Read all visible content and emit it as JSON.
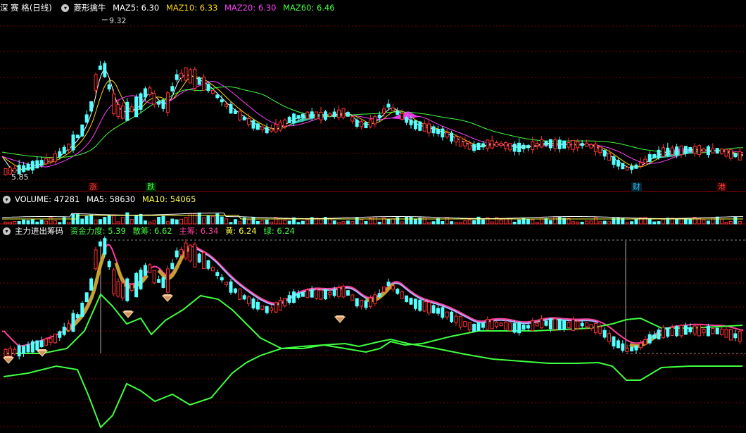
{
  "main_panel": {
    "stock_name": "深 赛 格",
    "period": "(日线)",
    "indicator_name": "菱形擒牛",
    "ma_values": [
      {
        "label": "MAZ5",
        "value": "6.30",
        "color": "#ffffff"
      },
      {
        "label": "MAZ10",
        "value": "6.33",
        "color": "#ffd700"
      },
      {
        "label": "MAZ20",
        "value": "6.30",
        "color": "#ff40ff"
      },
      {
        "label": "MAZ60",
        "value": "6.46",
        "color": "#40ff40"
      }
    ],
    "high_label": "9.32",
    "low_label": "5.85",
    "signals": [
      {
        "text": "涨",
        "color": "#ff4040"
      },
      {
        "text": "跌",
        "color": "#40ff40"
      },
      {
        "text": "财",
        "color": "#40c0ff"
      },
      {
        "text": "港",
        "color": "#ff4040"
      }
    ]
  },
  "volume_panel": {
    "label": "VOLUME",
    "value": "47281",
    "ma5_label": "MA5",
    "ma5": "58630",
    "ma10_label": "MA10",
    "ma10": "54065"
  },
  "indicator_panel": {
    "name": "主力进出筹码",
    "items": [
      {
        "label": "资金力度",
        "value": "5.39",
        "color": "#40ff40"
      },
      {
        "label": "散筹",
        "value": "6.62",
        "color": "#40ff40"
      },
      {
        "label": "主筹",
        "value": "6.34",
        "color": "#ff40a0"
      },
      {
        "label": "黄",
        "value": "6.24",
        "color": "#ffff40"
      },
      {
        "label": "绿",
        "value": "6.24",
        "color": "#40ff40"
      }
    ]
  },
  "colors": {
    "up": "#ff3232",
    "down": "#54ffff",
    "grid": "#7a0000",
    "border": "#a00000"
  }
}
